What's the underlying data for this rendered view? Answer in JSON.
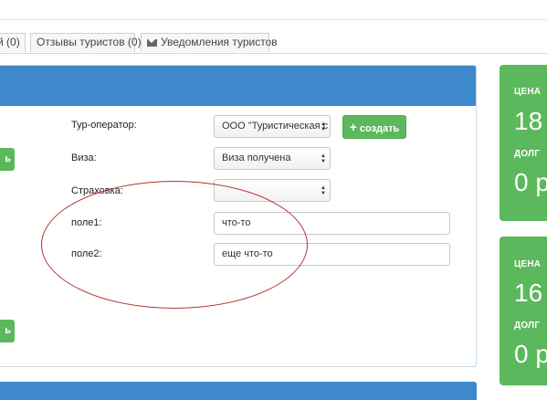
{
  "tabs": [
    {
      "label": "й (0)"
    },
    {
      "label": "Отзывы туристов (0)"
    },
    {
      "label": "Уведомления туристов",
      "icon": "envelope-icon"
    }
  ],
  "form": {
    "left_button_label": "ь",
    "tour_operator": {
      "label": "Тур-оператор:",
      "value": "ООО \"Туристическая с"
    },
    "create_button": "создать",
    "visa": {
      "label": "Виза:",
      "value": "Виза получена"
    },
    "insurance": {
      "label": "Страховка:",
      "value": ""
    },
    "field1": {
      "label": "поле1:",
      "value": "что-то"
    },
    "field2": {
      "label": "поле2:",
      "value": "еще что-то"
    }
  },
  "cards": [
    {
      "price_label": "ЦЕНА",
      "price_value": "18",
      "debt_label": "ДОЛГ",
      "debt_value": "0 р"
    },
    {
      "price_label": "ЦЕНА",
      "price_value": "16",
      "debt_label": "ДОЛГ",
      "debt_value": "0 р"
    }
  ],
  "colors": {
    "panel_header": "#3e89cc",
    "green": "#5cb85c",
    "annotation": "#b5302f"
  }
}
